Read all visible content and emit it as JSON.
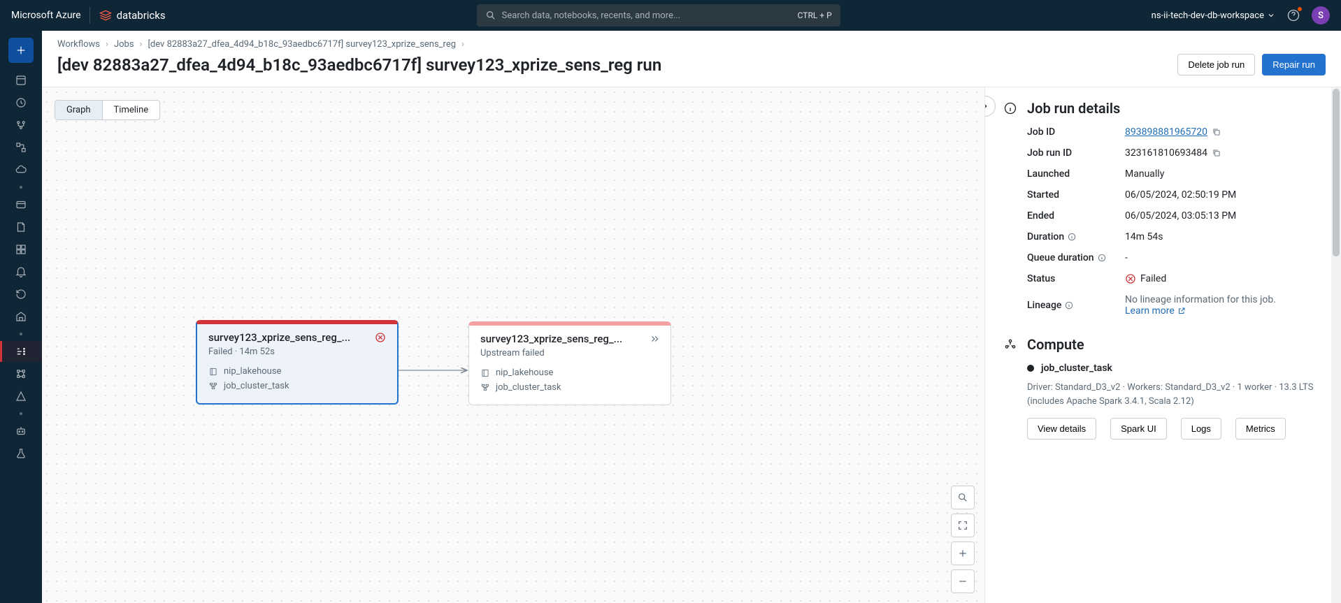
{
  "topbar": {
    "brand_azure": "Microsoft Azure",
    "brand_db": "databricks",
    "search_placeholder": "Search data, notebooks, recents, and more...",
    "search_shortcut": "CTRL + P",
    "workspace": "ns-ii-tech-dev-db-workspace",
    "avatar_initial": "S"
  },
  "breadcrumbs": {
    "workflows": "Workflows",
    "jobs": "Jobs",
    "job_name": "[dev 82883a27_dfea_4d94_b18c_93aedbc6717f] survey123_xprize_sens_reg"
  },
  "page_title": "[dev 82883a27_dfea_4d94_b18c_93aedbc6717f] survey123_xprize_sens_reg run",
  "actions": {
    "delete": "Delete job run",
    "repair": "Repair run"
  },
  "view_tabs": {
    "graph": "Graph",
    "timeline": "Timeline"
  },
  "tasks": [
    {
      "title": "survey123_xprize_sens_reg_...",
      "status": "Failed · 14m 52s",
      "catalog": "nip_lakehouse",
      "cluster": "job_cluster_task",
      "state": "failed"
    },
    {
      "title": "survey123_xprize_sens_reg_...",
      "status": "Upstream failed",
      "catalog": "nip_lakehouse",
      "cluster": "job_cluster_task",
      "state": "upstream"
    }
  ],
  "details": {
    "heading": "Job run details",
    "labels": {
      "job_id": "Job ID",
      "run_id": "Job run ID",
      "launched": "Launched",
      "started": "Started",
      "ended": "Ended",
      "duration": "Duration",
      "queue": "Queue duration",
      "status": "Status",
      "lineage": "Lineage"
    },
    "job_id": "893898881965720",
    "run_id": "323161810693484",
    "launched": "Manually",
    "started": "06/05/2024, 02:50:19 PM",
    "ended": "06/05/2024, 03:05:13 PM",
    "duration": "14m 54s",
    "queue": "-",
    "status": "Failed",
    "lineage_text": "No lineage information for this job.",
    "learn_more": "Learn more"
  },
  "compute": {
    "heading": "Compute",
    "cluster_name": "job_cluster_task",
    "description": "Driver: Standard_D3_v2 · Workers: Standard_D3_v2 · 1 worker · 13.3 LTS (includes Apache Spark 3.4.1, Scala 2.12)",
    "btn_view": "View details",
    "btn_spark": "Spark UI",
    "btn_logs": "Logs",
    "btn_metrics": "Metrics"
  }
}
